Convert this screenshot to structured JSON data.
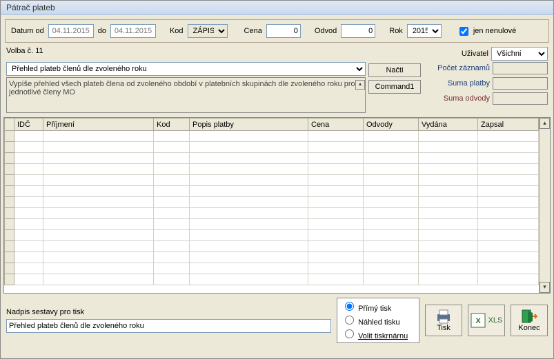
{
  "title": "Pátrač plateb",
  "top": {
    "datum_od_lbl": "Datum od",
    "datum_od": "04.11.2015",
    "do_lbl": "do",
    "do": "04.11.2015",
    "kod_lbl": "Kod",
    "kod_value": "ZÁPIS",
    "cena_lbl": "Cena",
    "cena": "0",
    "odvod_lbl": "Odvod",
    "odvod": "0",
    "rok_lbl": "Rok",
    "rok": "2015",
    "jen_nenulove": "jen nenulové"
  },
  "volba": {
    "lbl": "Volba č. 11",
    "uzivatel_lbl": "Uživatel",
    "uzivatel": "Všichni"
  },
  "dropdown": "Přehled plateb členů dle zvoleného roku",
  "desc": "Vypíše přehled všech plateb člena od zvoleného období v platebních skupinách dle zvoleného roku pro jednotlivé členy MO",
  "buttons": {
    "nacti": "Načti",
    "command1": "Command1"
  },
  "right": {
    "pocet": "Počet záznamů",
    "suma_platby": "Suma platby",
    "suma_odvody": "Suma odvody"
  },
  "grid": {
    "headers": [
      "IDČ",
      "Příjmení",
      "Kod",
      "Popis platby",
      "Cena",
      "Odvody",
      "Vydána",
      "Zapsal"
    ]
  },
  "footer": {
    "nadpis_lbl": "Nadpis sestavy pro tisk",
    "nadpis": "Přehled plateb členů dle zvoleného roku",
    "r1": "Přímý tisk",
    "r2": "Náhled tisku",
    "r3": "Volit tiskrnárnu",
    "tisk": "Tisk",
    "xls": "XLS",
    "konec": "Konec"
  }
}
